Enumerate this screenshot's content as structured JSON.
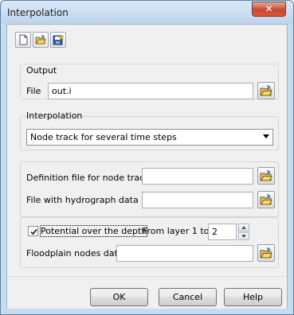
{
  "window": {
    "title": "Interpolation",
    "close_glyph": "✕"
  },
  "toolbar": {
    "icons": [
      "new-document-icon",
      "open-folder-icon",
      "save-disk-icon"
    ]
  },
  "output": {
    "group_title": "Output",
    "file_label": "File",
    "file_value": "out.i"
  },
  "interpolation": {
    "group_title": "Interpolation",
    "selected": "Node track for several time steps"
  },
  "node_track": {
    "definition_label": "Definition file for node track",
    "definition_value": "",
    "hydrograph_label": "File with hydrograph data",
    "hydrograph_value": ""
  },
  "depth": {
    "checkbox_label": "Potential over the depth",
    "checked": true,
    "from_layer_label": "From layer  1 to",
    "layer_value": "2",
    "floodplain_label": "Floodplain nodes data",
    "floodplain_value": ""
  },
  "buttons": {
    "ok": "OK",
    "cancel": "Cancel",
    "help": "Help"
  }
}
